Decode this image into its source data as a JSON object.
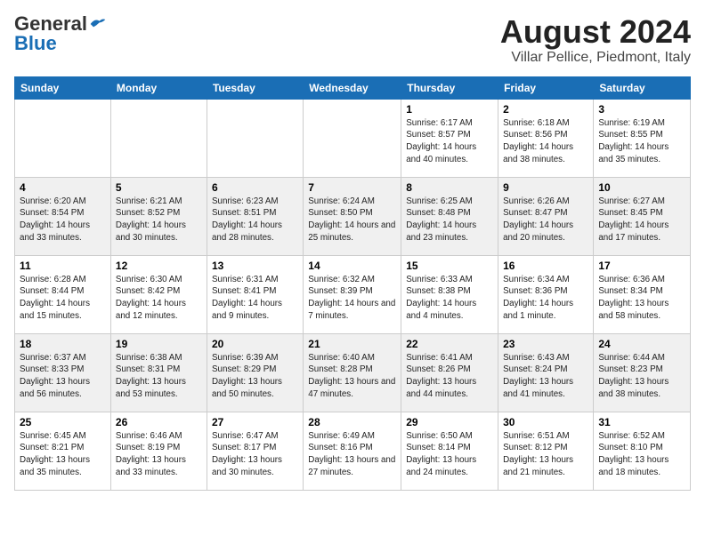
{
  "header": {
    "logo_general": "General",
    "logo_blue": "Blue",
    "month": "August 2024",
    "location": "Villar Pellice, Piedmont, Italy"
  },
  "days_of_week": [
    "Sunday",
    "Monday",
    "Tuesday",
    "Wednesday",
    "Thursday",
    "Friday",
    "Saturday"
  ],
  "weeks": [
    [
      {
        "day": "",
        "info": ""
      },
      {
        "day": "",
        "info": ""
      },
      {
        "day": "",
        "info": ""
      },
      {
        "day": "",
        "info": ""
      },
      {
        "day": "1",
        "info": "Sunrise: 6:17 AM\nSunset: 8:57 PM\nDaylight: 14 hours and 40 minutes."
      },
      {
        "day": "2",
        "info": "Sunrise: 6:18 AM\nSunset: 8:56 PM\nDaylight: 14 hours and 38 minutes."
      },
      {
        "day": "3",
        "info": "Sunrise: 6:19 AM\nSunset: 8:55 PM\nDaylight: 14 hours and 35 minutes."
      }
    ],
    [
      {
        "day": "4",
        "info": "Sunrise: 6:20 AM\nSunset: 8:54 PM\nDaylight: 14 hours and 33 minutes."
      },
      {
        "day": "5",
        "info": "Sunrise: 6:21 AM\nSunset: 8:52 PM\nDaylight: 14 hours and 30 minutes."
      },
      {
        "day": "6",
        "info": "Sunrise: 6:23 AM\nSunset: 8:51 PM\nDaylight: 14 hours and 28 minutes."
      },
      {
        "day": "7",
        "info": "Sunrise: 6:24 AM\nSunset: 8:50 PM\nDaylight: 14 hours and 25 minutes."
      },
      {
        "day": "8",
        "info": "Sunrise: 6:25 AM\nSunset: 8:48 PM\nDaylight: 14 hours and 23 minutes."
      },
      {
        "day": "9",
        "info": "Sunrise: 6:26 AM\nSunset: 8:47 PM\nDaylight: 14 hours and 20 minutes."
      },
      {
        "day": "10",
        "info": "Sunrise: 6:27 AM\nSunset: 8:45 PM\nDaylight: 14 hours and 17 minutes."
      }
    ],
    [
      {
        "day": "11",
        "info": "Sunrise: 6:28 AM\nSunset: 8:44 PM\nDaylight: 14 hours and 15 minutes."
      },
      {
        "day": "12",
        "info": "Sunrise: 6:30 AM\nSunset: 8:42 PM\nDaylight: 14 hours and 12 minutes."
      },
      {
        "day": "13",
        "info": "Sunrise: 6:31 AM\nSunset: 8:41 PM\nDaylight: 14 hours and 9 minutes."
      },
      {
        "day": "14",
        "info": "Sunrise: 6:32 AM\nSunset: 8:39 PM\nDaylight: 14 hours and 7 minutes."
      },
      {
        "day": "15",
        "info": "Sunrise: 6:33 AM\nSunset: 8:38 PM\nDaylight: 14 hours and 4 minutes."
      },
      {
        "day": "16",
        "info": "Sunrise: 6:34 AM\nSunset: 8:36 PM\nDaylight: 14 hours and 1 minute."
      },
      {
        "day": "17",
        "info": "Sunrise: 6:36 AM\nSunset: 8:34 PM\nDaylight: 13 hours and 58 minutes."
      }
    ],
    [
      {
        "day": "18",
        "info": "Sunrise: 6:37 AM\nSunset: 8:33 PM\nDaylight: 13 hours and 56 minutes."
      },
      {
        "day": "19",
        "info": "Sunrise: 6:38 AM\nSunset: 8:31 PM\nDaylight: 13 hours and 53 minutes."
      },
      {
        "day": "20",
        "info": "Sunrise: 6:39 AM\nSunset: 8:29 PM\nDaylight: 13 hours and 50 minutes."
      },
      {
        "day": "21",
        "info": "Sunrise: 6:40 AM\nSunset: 8:28 PM\nDaylight: 13 hours and 47 minutes."
      },
      {
        "day": "22",
        "info": "Sunrise: 6:41 AM\nSunset: 8:26 PM\nDaylight: 13 hours and 44 minutes."
      },
      {
        "day": "23",
        "info": "Sunrise: 6:43 AM\nSunset: 8:24 PM\nDaylight: 13 hours and 41 minutes."
      },
      {
        "day": "24",
        "info": "Sunrise: 6:44 AM\nSunset: 8:23 PM\nDaylight: 13 hours and 38 minutes."
      }
    ],
    [
      {
        "day": "25",
        "info": "Sunrise: 6:45 AM\nSunset: 8:21 PM\nDaylight: 13 hours and 35 minutes."
      },
      {
        "day": "26",
        "info": "Sunrise: 6:46 AM\nSunset: 8:19 PM\nDaylight: 13 hours and 33 minutes."
      },
      {
        "day": "27",
        "info": "Sunrise: 6:47 AM\nSunset: 8:17 PM\nDaylight: 13 hours and 30 minutes."
      },
      {
        "day": "28",
        "info": "Sunrise: 6:49 AM\nSunset: 8:16 PM\nDaylight: 13 hours and 27 minutes."
      },
      {
        "day": "29",
        "info": "Sunrise: 6:50 AM\nSunset: 8:14 PM\nDaylight: 13 hours and 24 minutes."
      },
      {
        "day": "30",
        "info": "Sunrise: 6:51 AM\nSunset: 8:12 PM\nDaylight: 13 hours and 21 minutes."
      },
      {
        "day": "31",
        "info": "Sunrise: 6:52 AM\nSunset: 8:10 PM\nDaylight: 13 hours and 18 minutes."
      }
    ]
  ]
}
